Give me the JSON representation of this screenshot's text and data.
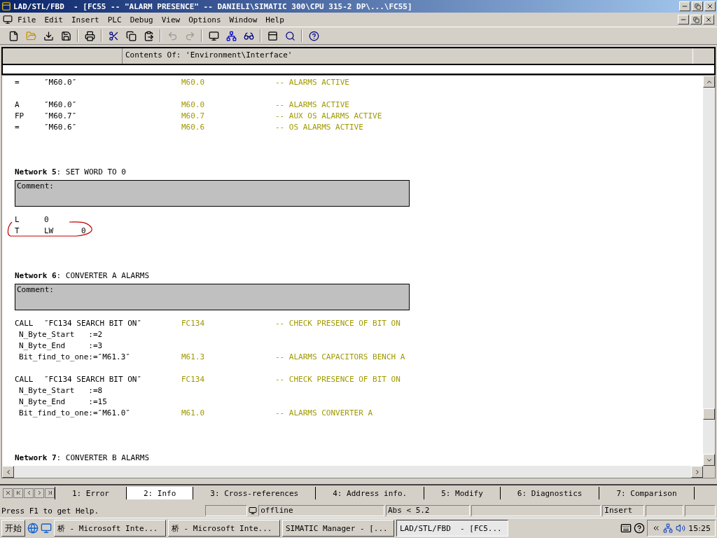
{
  "window": {
    "title": "LAD/STL/FBD  - [FC55 -- \"ALARM PRESENCE\" -- DANIELI\\SIMATIC 300\\CPU 315-2 DP\\...\\FC55]"
  },
  "menu": [
    "File",
    "Edit",
    "Insert",
    "PLC",
    "Debug",
    "View",
    "Options",
    "Window",
    "Help"
  ],
  "panel": {
    "heading": "Contents Of: 'Environment\\Interface'"
  },
  "code": [
    {
      "kind": "stmt",
      "op": "=",
      "operand": "″M60.0″",
      "address": "M60.0",
      "comment": "-- ALARMS ACTIVE",
      "circled": false
    },
    {
      "kind": "blank"
    },
    {
      "kind": "stmt",
      "op": "A",
      "operand": "″M60.0″",
      "address": "M60.0",
      "comment": "-- ALARMS ACTIVE",
      "circled": false
    },
    {
      "kind": "stmt",
      "op": "FP",
      "operand": "″M60.7″",
      "address": "M60.7",
      "comment": "-- AUX OS ALARMS ACTIVE",
      "circled": false
    },
    {
      "kind": "stmt",
      "op": "=",
      "operand": "″M60.6″",
      "address": "M60.6",
      "comment": "-- OS ALARMS ACTIVE",
      "circled": false
    },
    {
      "kind": "gap"
    },
    {
      "kind": "network",
      "text": "**Network 5**: SET WORD TO 0"
    },
    {
      "kind": "comment_box",
      "label": "Comment:"
    },
    {
      "kind": "stmt",
      "op": "L",
      "operand": "0",
      "circled": false
    },
    {
      "kind": "stmt",
      "op": "T",
      "operand": "LW      0",
      "circled": true
    },
    {
      "kind": "gap"
    },
    {
      "kind": "network",
      "text": "**Network 6**: CONVERTER A ALARMS"
    },
    {
      "kind": "comment_box",
      "label": "Comment:"
    },
    {
      "kind": "stmt",
      "op": "CALL",
      "operand": "″FC134 SEARCH BIT ON″",
      "address": "FC134",
      "comment": "-- CHECK PRESENCE OF BIT ON",
      "circled": false
    },
    {
      "kind": "param",
      "text": "N_Byte_Start   :=2"
    },
    {
      "kind": "param",
      "text": "N_Byte_End     :=3"
    },
    {
      "kind": "param",
      "text": "Bit_find_to_one:=″M61.3″",
      "address": "M61.3",
      "comment": "-- ALARMS CAPACITORS BENCH A"
    },
    {
      "kind": "blank"
    },
    {
      "kind": "stmt",
      "op": "CALL",
      "operand": "″FC134 SEARCH BIT ON″",
      "address": "FC134",
      "comment": "-- CHECK PRESENCE OF BIT ON",
      "circled": false
    },
    {
      "kind": "param",
      "text": "N_Byte_Start   :=8"
    },
    {
      "kind": "param",
      "text": "N_Byte_End     :=15"
    },
    {
      "kind": "param",
      "text": "Bit_find_to_one:=″M61.0″",
      "address": "M61.0",
      "comment": "-- ALARMS CONVERTER A"
    },
    {
      "kind": "gap"
    },
    {
      "kind": "network",
      "text": "**Network 7**: CONVERTER B ALARMS"
    }
  ],
  "tabs": [
    {
      "label": "1: Error",
      "selected": false
    },
    {
      "label": "2: Info",
      "selected": true
    },
    {
      "label": "3: Cross-references",
      "selected": false
    },
    {
      "label": "4: Address info.",
      "selected": false
    },
    {
      "label": "5: Modify",
      "selected": false
    },
    {
      "label": "6: Diagnostics",
      "selected": false
    },
    {
      "label": "7: Comparison",
      "selected": false
    }
  ],
  "status_bar": {
    "help": "Press F1 to get Help.",
    "mode": "offline",
    "position": "Abs < 5.2",
    "insert": "Insert"
  },
  "taskbar": {
    "start": "开始",
    "buttons": [
      {
        "label": "桥 - Microsoft Inte...",
        "selected": false
      },
      {
        "label": "桥 - Microsoft Inte...",
        "selected": false
      },
      {
        "label": "SIMATIC Manager - [...",
        "selected": false
      },
      {
        "label": "LAD/STL/FBD  - [FC5...",
        "selected": true
      }
    ],
    "clock": "15:25"
  }
}
